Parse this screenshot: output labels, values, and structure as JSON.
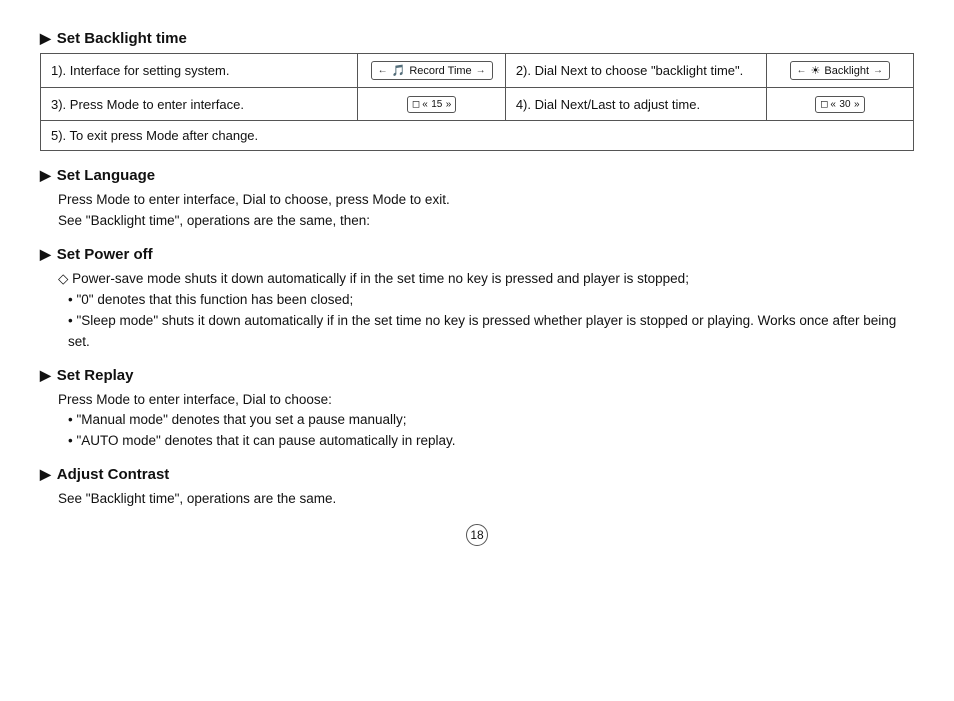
{
  "sections": {
    "backlight": {
      "title": "Set Backlight time",
      "cell1_text": "1). Interface for setting system.",
      "cell1_ui_icon": "🎵",
      "cell1_ui_label": "Record Time",
      "cell2_text": "2). Dial Next to choose \"backlight time\".",
      "cell2_ui_label": "Backlight",
      "cell3_text": "3). Press Mode to enter interface.",
      "cell3_slider_value": "15",
      "cell4_text": "4). Dial Next/Last to adjust time.",
      "cell4_slider_value": "30",
      "cell5_text": "5). To exit press Mode after change."
    },
    "language": {
      "title": "Set Language",
      "body": "Press Mode to enter interface, Dial to choose, press Mode to exit.\nSee \"Backlight time\", operations are the same, then:"
    },
    "power_off": {
      "title": "Set Power off",
      "line1": "◇ Power-save mode shuts it down automatically if in the set time no key is pressed and player is stopped;",
      "line2": "• \"0\" denotes that this function has been closed;",
      "line3": "• \"Sleep mode\" shuts it down automatically if in the set time no key is pressed whether player is stopped or playing. Works once after being set."
    },
    "replay": {
      "title": "Set Replay",
      "line1": "Press Mode to enter interface, Dial to choose:",
      "line2": "• \"Manual mode\" denotes that you set a pause manually;",
      "line3": "• \"AUTO mode\" denotes that it can pause automatically in replay."
    },
    "contrast": {
      "title": "Adjust Contrast",
      "body": "See \"Backlight time\", operations are the same."
    }
  },
  "page_number": "18"
}
